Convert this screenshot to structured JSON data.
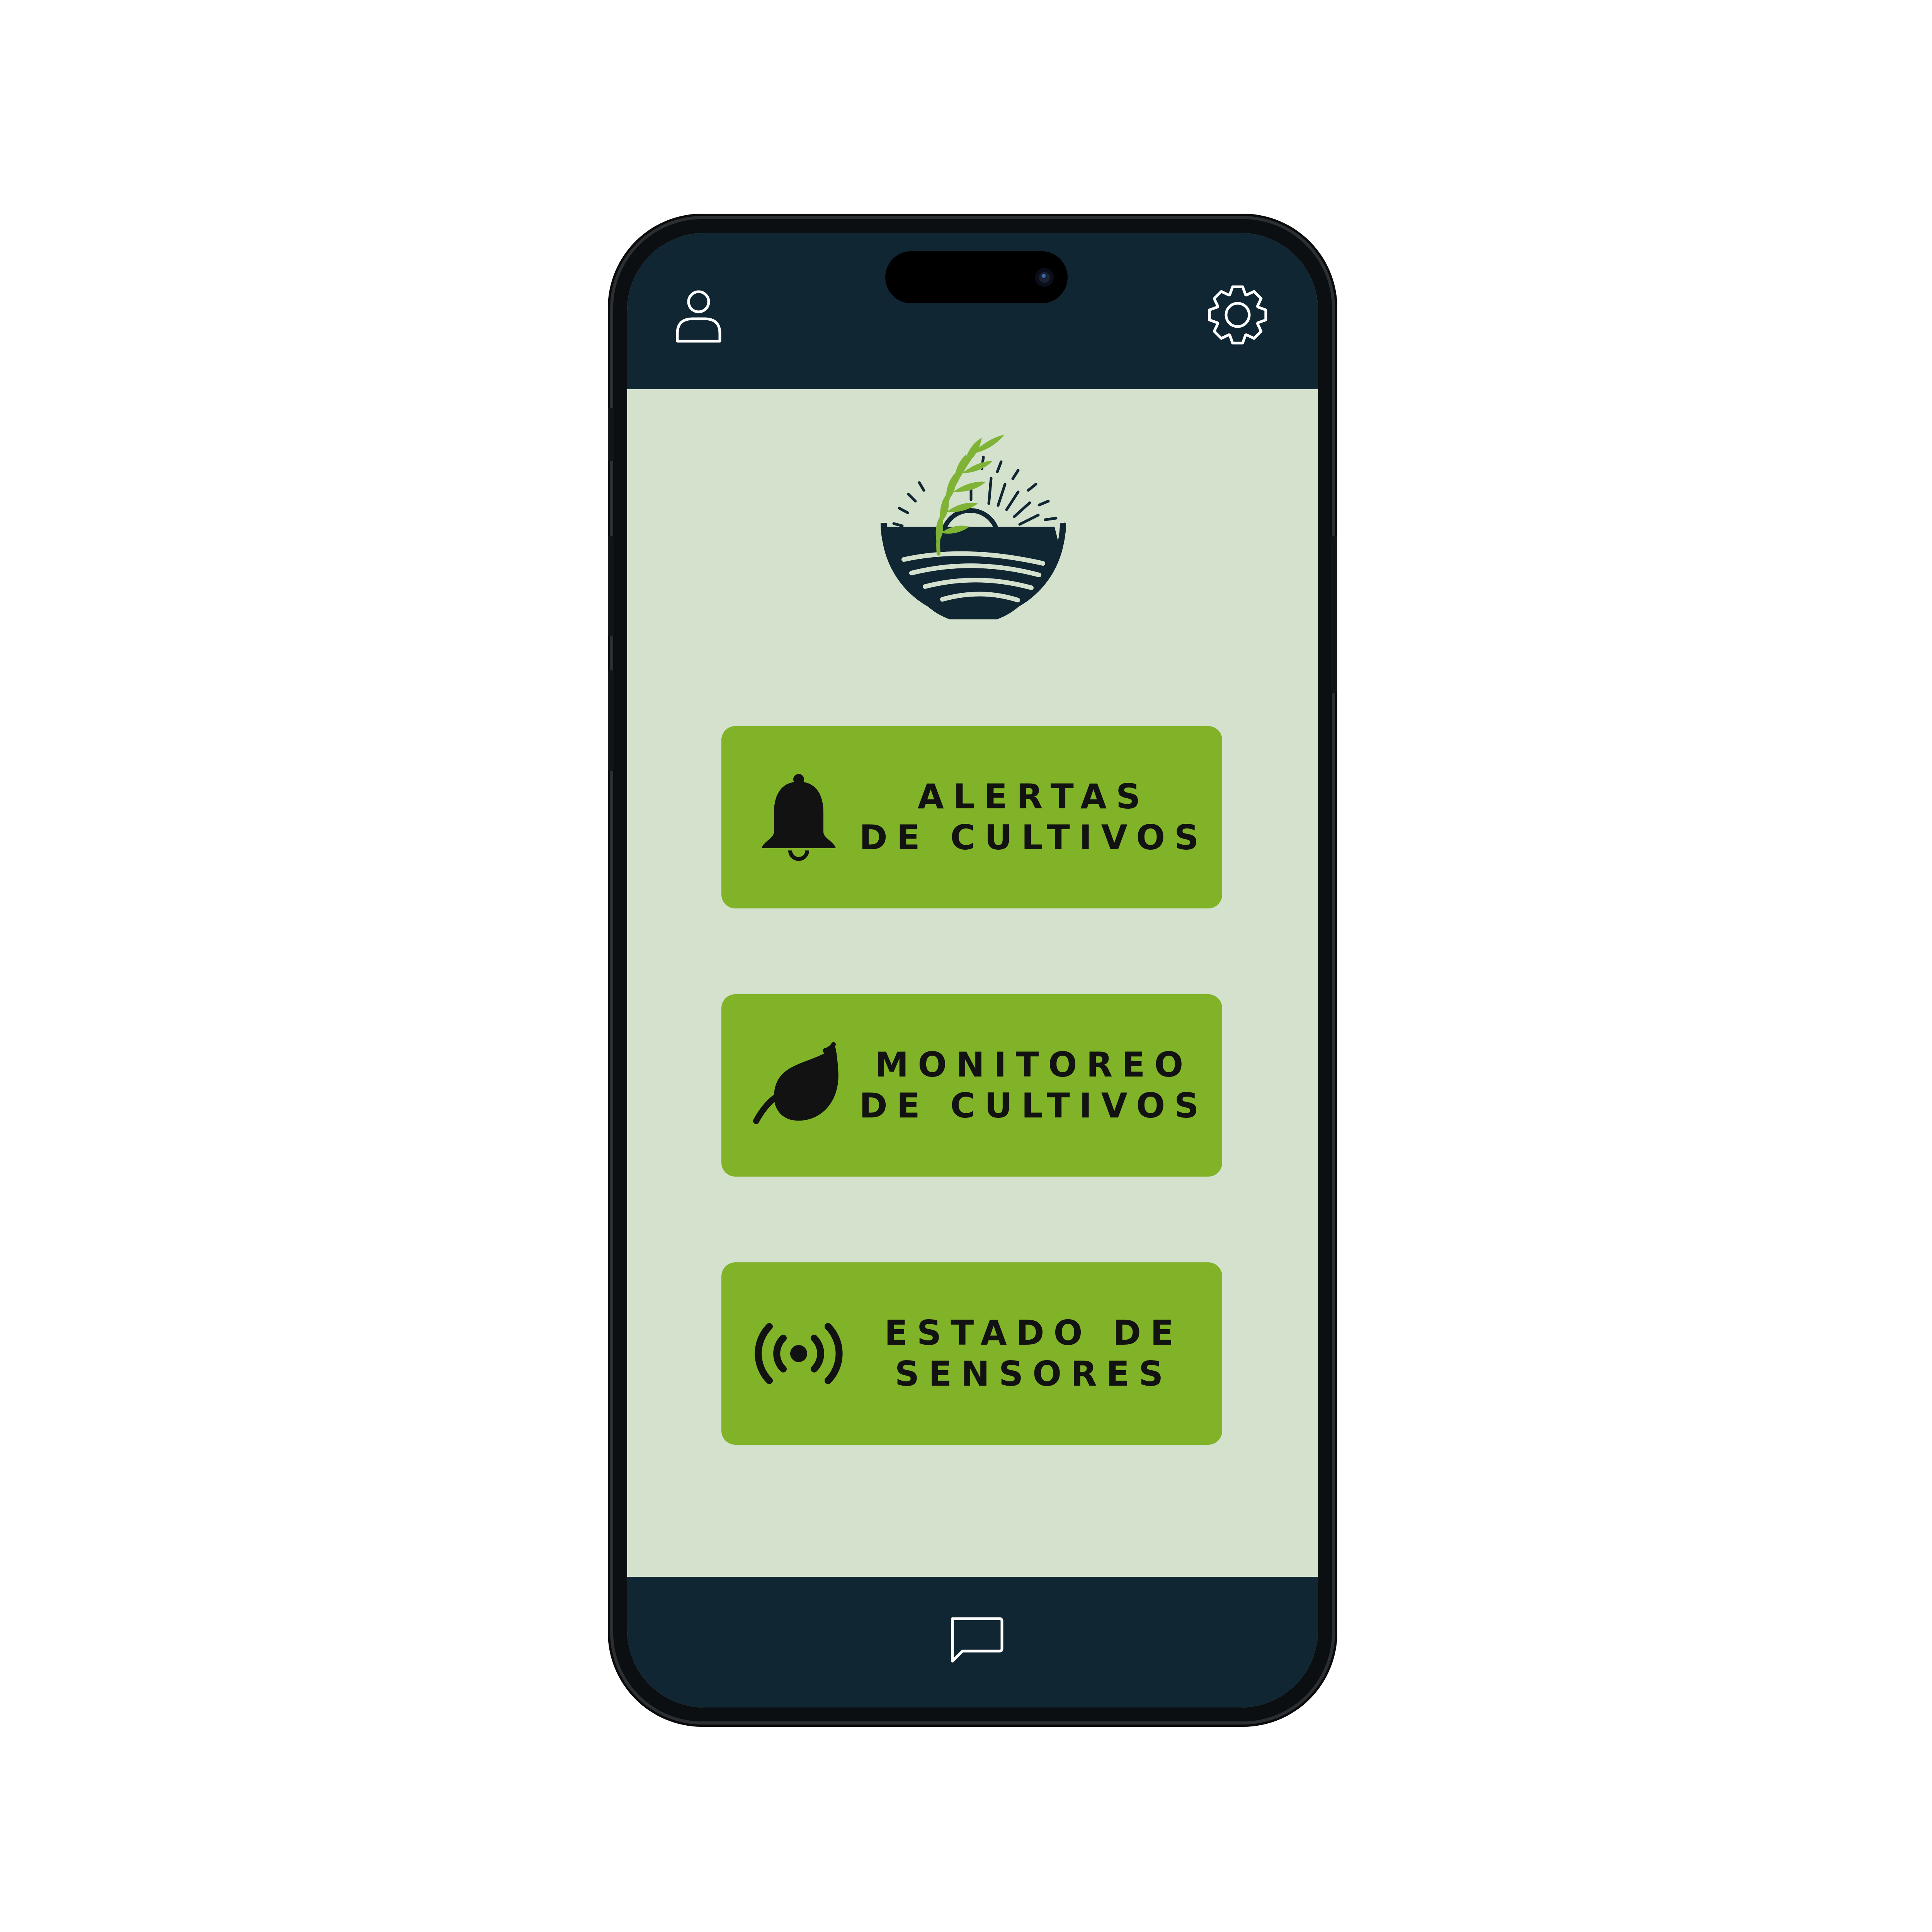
{
  "header": {
    "profile_icon": "user-icon",
    "settings_icon": "gear-icon"
  },
  "logo": {
    "icon": "farm-sunrise-leaf-logo"
  },
  "menu": [
    {
      "icon": "bell-icon",
      "line1": "ALERTAS",
      "line2": "DE CULTIVOS"
    },
    {
      "icon": "leaf-icon",
      "line1": "MONITOREO",
      "line2": "DE CULTIVOS"
    },
    {
      "icon": "broadcast-icon",
      "line1": "ESTADO DE",
      "line2": "SENSORES"
    }
  ],
  "footer": {
    "chat_icon": "chat-bubble-icon"
  },
  "colors": {
    "background": "#ffffff",
    "bar": "#102632",
    "screen": "#d3e1cd",
    "button": "#80b328",
    "button_text": "#121212",
    "logo_green": "#7fb335",
    "logo_navy": "#102632"
  }
}
